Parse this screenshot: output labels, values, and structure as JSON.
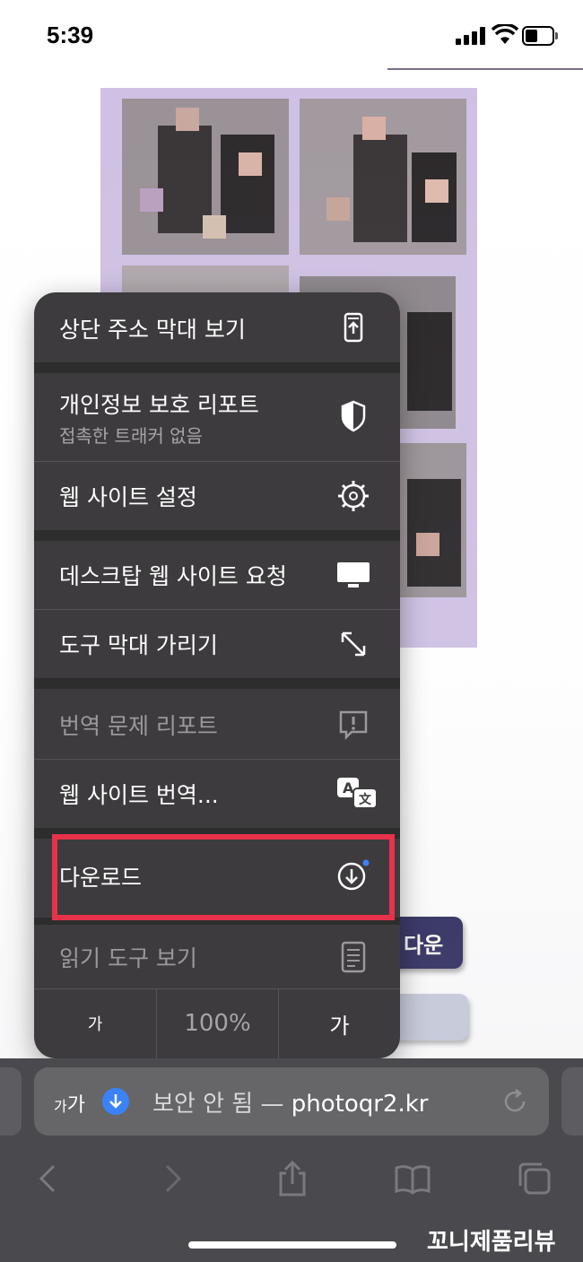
{
  "status_bar": {
    "time": "5:39"
  },
  "menu": {
    "items": [
      {
        "label": "상단 주소 막대 보기",
        "icon": "address-bar-top-icon"
      },
      {
        "label": "개인정보 보호 리포트",
        "sublabel": "접촉한 트래커 없음",
        "icon": "shield-icon"
      },
      {
        "label": "웹 사이트 설정",
        "icon": "gear-icon"
      },
      {
        "label": "데스크탑 웹 사이트 요청",
        "icon": "desktop-icon"
      },
      {
        "label": "도구 막대 가리기",
        "icon": "expand-arrows-icon"
      },
      {
        "label": "번역 문제 리포트",
        "icon": "report-bubble-icon",
        "disabled": true
      },
      {
        "label": "웹 사이트 번역...",
        "icon": "translate-icon"
      },
      {
        "label": "다운로드",
        "icon": "download-circle-icon"
      },
      {
        "label": "읽기 도구 보기",
        "icon": "reader-icon",
        "disabled": true
      }
    ],
    "zoom": {
      "decrease": "가",
      "value": "100%",
      "increase": "가"
    }
  },
  "page": {
    "download_button_label": "다운"
  },
  "address_bar": {
    "aa_label_small": "가",
    "aa_label": "가",
    "security_text": "보안 안 됨 — ",
    "host": "photoqr2.kr"
  },
  "watermark": "꼬니제품리뷰",
  "colors": {
    "menu_bg": "#3d3b3d",
    "highlight": "#e8324a",
    "accent_blue": "#3b82f6",
    "photo_frame": "#cfc1e3"
  }
}
